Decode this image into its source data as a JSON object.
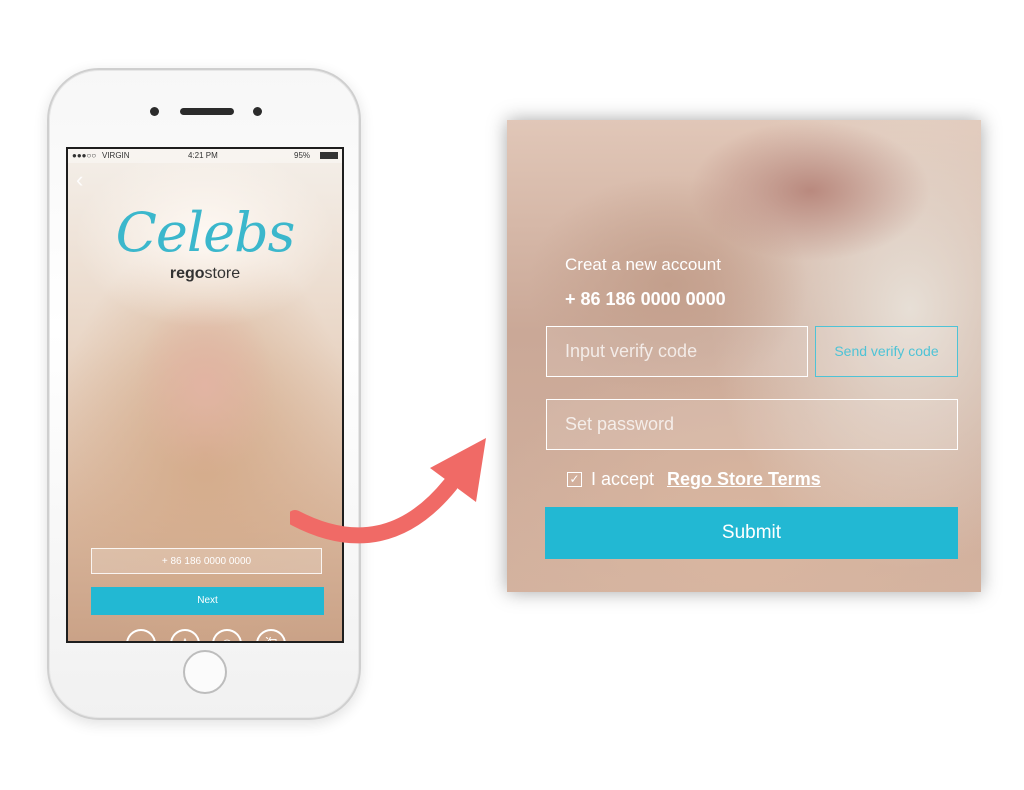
{
  "phone": {
    "status": {
      "carrier": "VIRGIN",
      "time": "4:21 PM",
      "battery": "95%"
    },
    "back_icon": "chevron-left-icon",
    "logo_script": "Celebs",
    "logo_rego": "rego",
    "logo_store": "store",
    "phone_value": "+ 86 186 0000 0000",
    "next_label": "Next",
    "social_icons": [
      {
        "name": "wechat-icon",
        "glyph": "◔"
      },
      {
        "name": "qq-icon",
        "glyph": "♙"
      },
      {
        "name": "weibo-icon",
        "glyph": "◉"
      },
      {
        "name": "taobao-icon",
        "glyph": "淘"
      }
    ]
  },
  "arrow_color": "#f06a66",
  "card": {
    "title": "Creat a new account",
    "phone_number": "+ 86 186 0000 0000",
    "verify_placeholder": "Input verify code",
    "send_code_label": "Send verify code",
    "password_placeholder": "Set password",
    "accept_checked": true,
    "accept_label": "I accept",
    "terms_label": "Rego Store Terms",
    "submit_label": "Submit"
  },
  "colors": {
    "accent": "#22b8d3",
    "arrow": "#f06a66"
  }
}
